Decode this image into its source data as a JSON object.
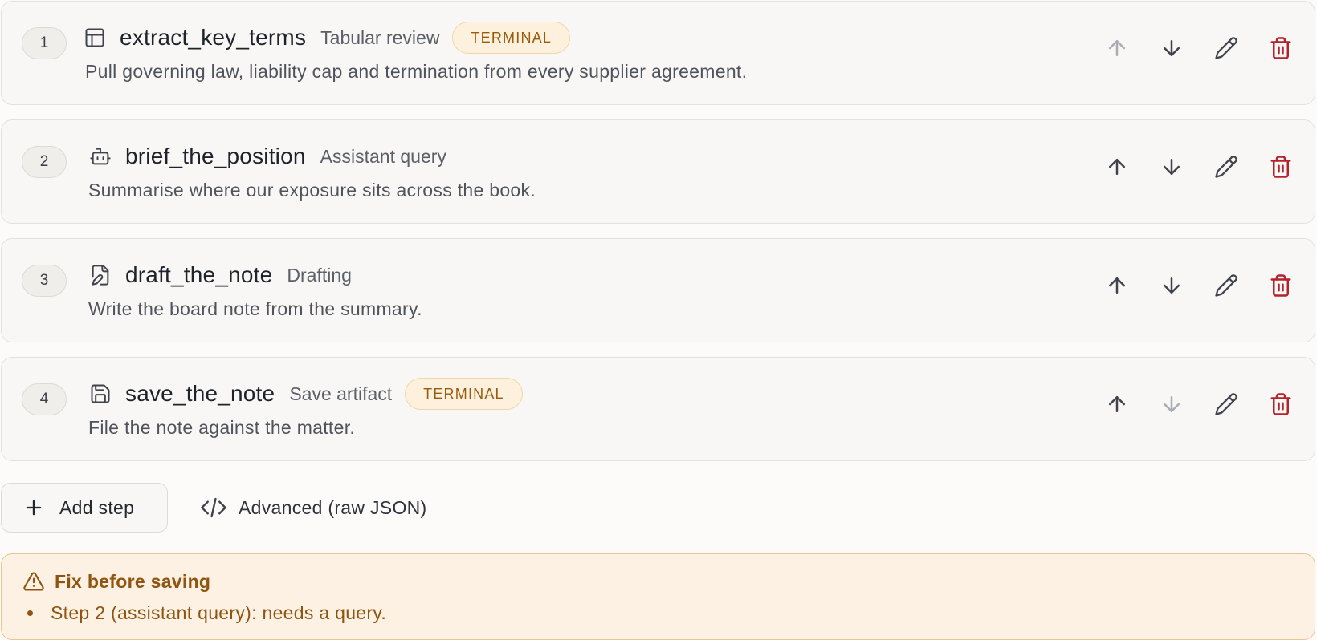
{
  "steps": [
    {
      "number": "1",
      "name": "extract_key_terms",
      "type_label": "Tabular review",
      "icon": "table-icon",
      "badge": "TERMINAL",
      "description": "Pull governing law, liability cap and termination from every supplier agreement.",
      "move_up_enabled": false,
      "move_down_enabled": true
    },
    {
      "number": "2",
      "name": "brief_the_position",
      "type_label": "Assistant query",
      "icon": "bot-icon",
      "badge": "",
      "description": "Summarise where our exposure sits across the book.",
      "move_up_enabled": true,
      "move_down_enabled": true
    },
    {
      "number": "3",
      "name": "draft_the_note",
      "type_label": "Drafting",
      "icon": "file-pen-icon",
      "badge": "",
      "description": "Write the board note from the summary.",
      "move_up_enabled": true,
      "move_down_enabled": true
    },
    {
      "number": "4",
      "name": "save_the_note",
      "type_label": "Save artifact",
      "icon": "save-icon",
      "badge": "TERMINAL",
      "description": "File the note against the matter.",
      "move_up_enabled": true,
      "move_down_enabled": false
    }
  ],
  "toolbar": {
    "add_step_label": "Add step",
    "advanced_label": "Advanced (raw JSON)"
  },
  "warning": {
    "title": "Fix before saving",
    "items": [
      "Step 2 (assistant query): needs a query."
    ]
  },
  "colors": {
    "danger": "#b4232a",
    "icon": "#3f434b",
    "icon_disabled": "#a9acb2",
    "badge_text": "#9a5b0c",
    "warning_text": "#8f540f"
  }
}
